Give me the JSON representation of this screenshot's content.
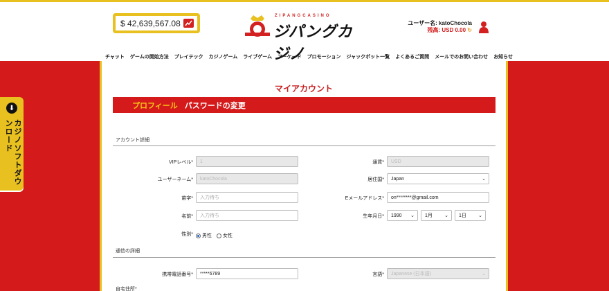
{
  "header": {
    "jackpot": "$ 42,639,567.08",
    "logo_small": "ZIPANGCASINO",
    "logo_text": "ジパングカジノ",
    "username_label": "ユーザー名: katoChocola",
    "balance_label": "残高: USD 0.00"
  },
  "nav": [
    "チャット",
    "ゲームの開始方法",
    "プレイテック",
    "カジノゲーム",
    "ライブゲーム",
    "アーケード",
    "プロモーション",
    "ジャックポット一覧",
    "よくあるご質問",
    "メールでのお問い合わせ",
    "お知らせ"
  ],
  "side_panel": {
    "label": "カジノソフトダウンロード"
  },
  "page": {
    "title": "マイアカウント",
    "tabs": [
      {
        "label": "プロフィール",
        "active": true
      },
      {
        "label": "パスワードの変更",
        "active": false
      }
    ],
    "section_account": "アカウント詳細",
    "section_contact": "通信の詳細",
    "section_address": "自宅住所*"
  },
  "form": {
    "vip_label": "VIPレベル*",
    "vip_value": "1",
    "username_label": "ユーザーネーム*",
    "username_value": "katoChocola",
    "lastname_label": "苗字*",
    "lastname_placeholder": "入力待ち",
    "firstname_label": "名前*",
    "firstname_placeholder": "入力待ち",
    "gender_label": "性別*",
    "gender_male": "男性",
    "gender_female": "女性",
    "gender_selected": "male",
    "currency_label": "通貨*",
    "currency_value": "USD",
    "country_label": "居住国*",
    "country_value": "Japan",
    "email_label": "Eメールアドレス*",
    "email_value": "on********@gmail.com",
    "dob_label": "生年月日*",
    "dob_year": "1990",
    "dob_month": "1月",
    "dob_day": "1日",
    "phone_label": "携帯電話番号*",
    "phone_value": "*****6789",
    "language_label": "言語*",
    "language_value": "Japanese (日本語)"
  },
  "colors": {
    "primary_red": "#d41a1a",
    "gold": "#e8c020",
    "title_red": "#c62020",
    "tab_active": "#f5c518"
  }
}
